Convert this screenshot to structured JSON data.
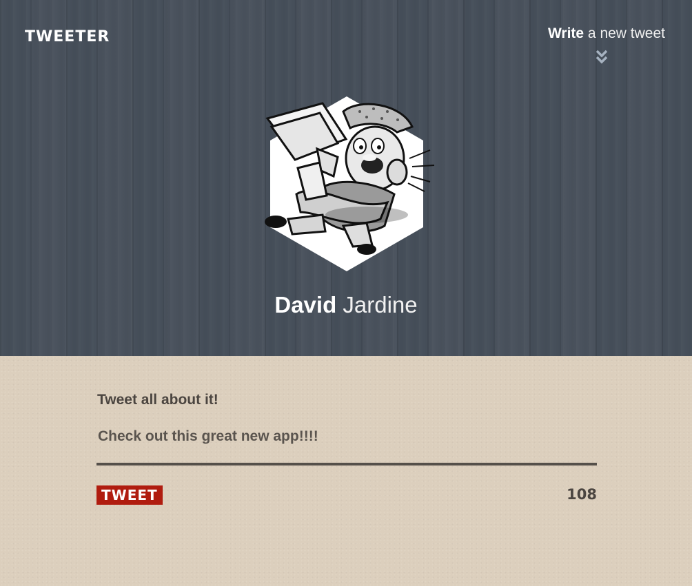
{
  "header": {
    "brand": "TWEETER",
    "write_link": {
      "strong": "Write",
      "rest": " a new tweet"
    },
    "chevron_icon": "double-chevron-down-icon"
  },
  "profile": {
    "avatar_icon": "newsboy-hexagon-avatar",
    "first_name": "David",
    "last_name": " Jardine"
  },
  "compose": {
    "label": "Tweet all about it!",
    "input_value": "Check out this great new app!!!!",
    "button_label": "TWEET",
    "char_count": "108"
  },
  "colors": {
    "header_bg": "#464f5a",
    "compose_bg": "#dccfbd",
    "button_bg": "#b01c0f",
    "text_dark": "#4b4540"
  }
}
